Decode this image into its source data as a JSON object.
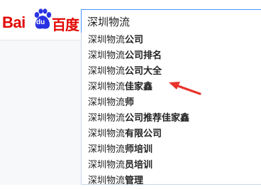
{
  "logo": {
    "latin": "Bai",
    "paw_text": "du",
    "chinese": "百度"
  },
  "search": {
    "value": "深圳物流"
  },
  "suggestions": [
    {
      "prefix": "深圳物流",
      "rest": "公司"
    },
    {
      "prefix": "深圳物流",
      "rest": "公司排名"
    },
    {
      "prefix": "深圳物流",
      "rest": "公司大全"
    },
    {
      "prefix": "深圳物流",
      "rest": "佳家鑫"
    },
    {
      "prefix": "深圳物流",
      "rest": "师"
    },
    {
      "prefix": "深圳物流",
      "rest": "公司推荐佳家鑫"
    },
    {
      "prefix": "深圳物流",
      "rest": "有限公司"
    },
    {
      "prefix": "深圳物流",
      "rest": "师培训"
    },
    {
      "prefix": "深圳物流",
      "rest": "员培训"
    },
    {
      "prefix": "深圳物流",
      "rest": "管理"
    }
  ],
  "colors": {
    "brand_red": "#e10602",
    "brand_blue": "#2932e1",
    "arrow_red": "#e8332c",
    "focus_border": "#4791ff"
  },
  "icons": {
    "logo_paw": "baidu-paw-icon",
    "annotation": "red-arrow-icon"
  }
}
